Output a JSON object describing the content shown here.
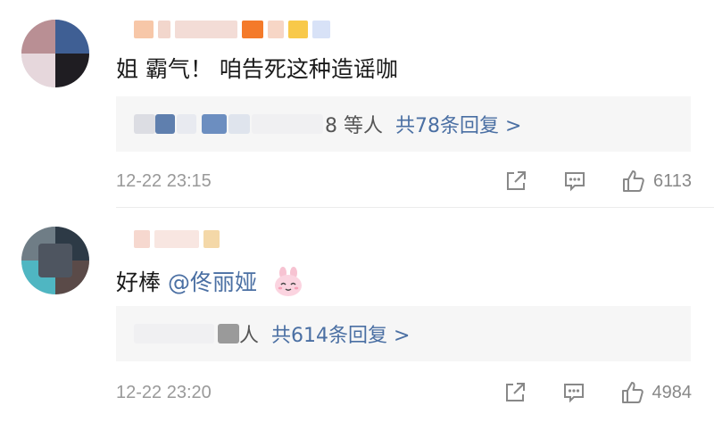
{
  "comments": [
    {
      "text": "姐 霸气！ 咱告死这种造谣咖",
      "replies": {
        "preview_suffix": "8 等人",
        "count_label": "共78条回复 >"
      },
      "timestamp": "12-22 23:15",
      "like_count": "6113"
    },
    {
      "text": "好棒",
      "mention": "@佟丽娅",
      "emoji_icon": "bunny-face-emoji",
      "replies": {
        "preview_suffix": "人",
        "count_label": "共614条回复 >"
      },
      "timestamp": "12-22 23:20",
      "like_count": "4984"
    }
  ],
  "icons": {
    "share": "share-icon",
    "comment": "comment-icon",
    "like": "thumbs-up-icon"
  },
  "colors": {
    "link": "#4a6fa3",
    "muted": "#999999",
    "reply_bg": "#f6f6f6"
  }
}
